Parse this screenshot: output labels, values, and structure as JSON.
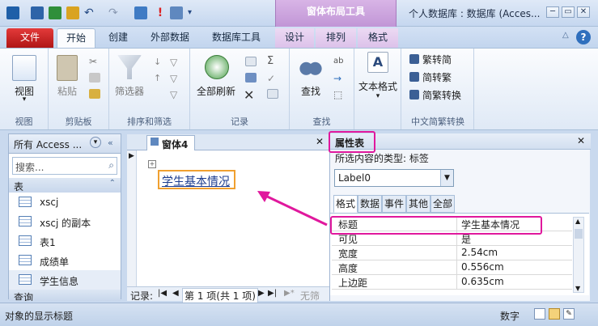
{
  "app": {
    "title": "个人数据库 : 数据库 (Acces...",
    "context_tab_header": "窗体布局工具",
    "window_buttons": [
      "─",
      "▭",
      "✕"
    ]
  },
  "ribbon_tabs": [
    {
      "label": "文件"
    },
    {
      "label": "开始"
    },
    {
      "label": "创建"
    },
    {
      "label": "外部数据"
    },
    {
      "label": "数据库工具"
    },
    {
      "label": "设计"
    },
    {
      "label": "排列"
    },
    {
      "label": "格式"
    }
  ],
  "ribbon": {
    "view": {
      "label": "视图",
      "group": "视图"
    },
    "clipboard": {
      "paste": "粘贴",
      "group": "剪贴板"
    },
    "sort_filter": {
      "filter": "筛选器",
      "group": "排序和筛选"
    },
    "records": {
      "refresh": "全部刷新",
      "group": "记录"
    },
    "find": {
      "find": "查找",
      "group": "查找"
    },
    "text_format": {
      "label": "文本格式"
    },
    "chinese": {
      "trad": "繁转简",
      "simp": "简转繁",
      "conv": "简繁转换",
      "group": "中文简繁转换"
    }
  },
  "nav": {
    "title": "所有 Access ...",
    "search_placeholder": "搜索...",
    "group_tables": "表",
    "group_queries": "查询",
    "items": [
      "xscj",
      "xscj 的副本",
      "表1",
      "成绩单",
      "学生信息"
    ]
  },
  "form": {
    "tab": "窗体4",
    "label_text": "学生基本情况",
    "record_label": "记录:",
    "record_position": "第 1 项(共 1 项)",
    "no_filter": "无筛"
  },
  "propsheet": {
    "title": "属性表",
    "selection_type_label": "所选内容的类型: 标签",
    "selected_control": "Label0",
    "tabs": [
      "格式",
      "数据",
      "事件",
      "其他",
      "全部"
    ],
    "rows": [
      {
        "key": "标题",
        "value": "学生基本情况"
      },
      {
        "key": "可见",
        "value": "是"
      },
      {
        "key": "宽度",
        "value": "2.54cm"
      },
      {
        "key": "高度",
        "value": "0.556cm"
      },
      {
        "key": "上边距",
        "value": "0.635cm"
      }
    ]
  },
  "status": {
    "message": "对象的显示标题",
    "mode": "数字"
  },
  "colors": {
    "annotation": "#e0189d",
    "file_tab": "#c61e1e",
    "context_tab": "#c196d6"
  }
}
